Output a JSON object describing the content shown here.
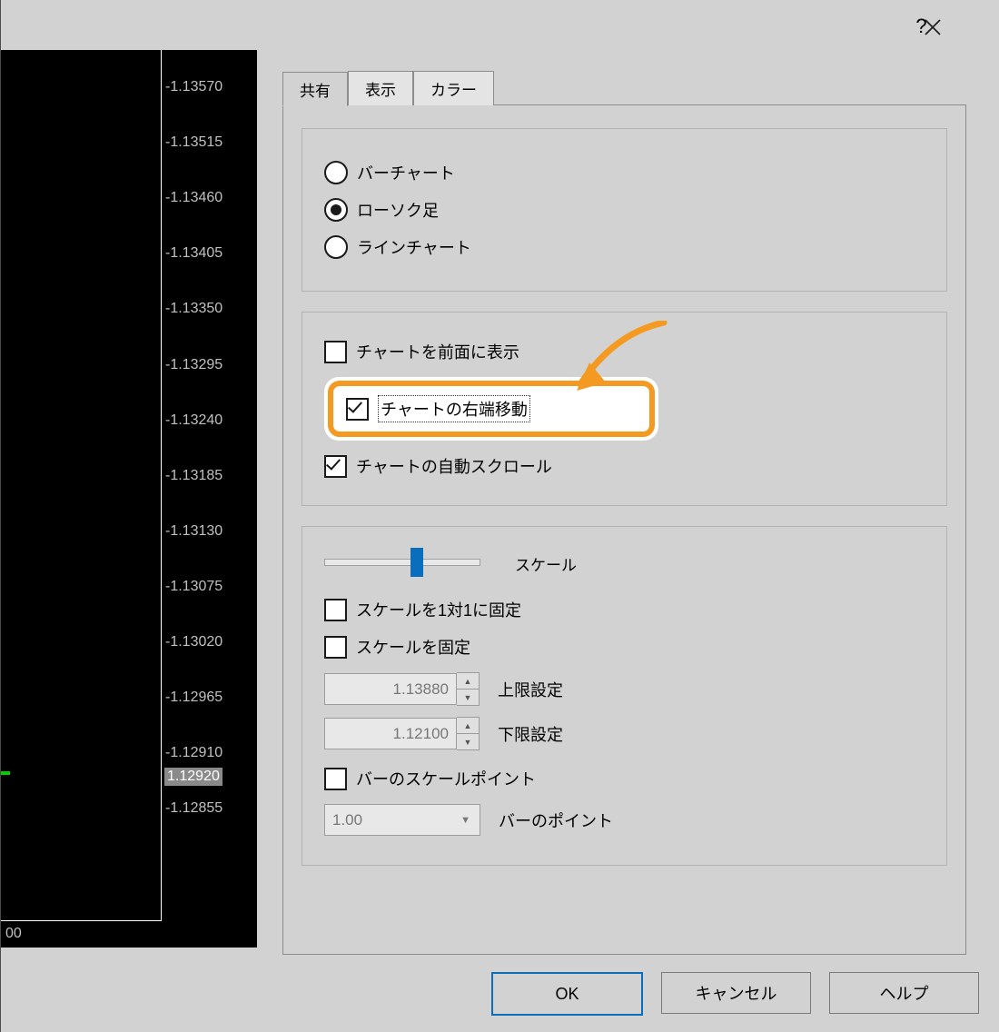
{
  "titlebar": {
    "help_tooltip": "?",
    "close_tooltip": "×"
  },
  "chart": {
    "y_ticks": [
      "1.13570",
      "1.13515",
      "1.13460",
      "1.13405",
      "1.13350",
      "1.13295",
      "1.13240",
      "1.13185",
      "1.13130",
      "1.13075",
      "1.13020",
      "1.12965",
      "1.12910",
      "1.12855"
    ],
    "price_highlight": "1.12920",
    "x_label": "00"
  },
  "tabs": {
    "t0": "共有",
    "t1": "表示",
    "t2": "カラー",
    "active": 0
  },
  "chart_type": {
    "bar": "バーチャート",
    "candle": "ローソク足",
    "line": "ラインチャート",
    "selected": "candle"
  },
  "options": {
    "chart_front": {
      "label": "チャートを前面に表示",
      "checked": false
    },
    "chart_shift": {
      "label": "チャートの右端移動",
      "checked": true
    },
    "chart_autoscroll": {
      "label": "チャートの自動スクロール",
      "checked": true
    }
  },
  "scale": {
    "label": "スケール",
    "fix_1to1": {
      "label": "スケールを1対1に固定",
      "checked": false
    },
    "fix_scale": {
      "label": "スケールを固定",
      "checked": false
    },
    "upper": {
      "value": "1.13880",
      "label": "上限設定"
    },
    "lower": {
      "value": "1.12100",
      "label": "下限設定"
    },
    "bar_scale_point": {
      "label": "バーのスケールポイント",
      "checked": false
    },
    "bar_point": {
      "value": "1.00",
      "label": "バーのポイント"
    }
  },
  "buttons": {
    "ok": "OK",
    "cancel": "キャンセル",
    "help": "ヘルプ"
  }
}
